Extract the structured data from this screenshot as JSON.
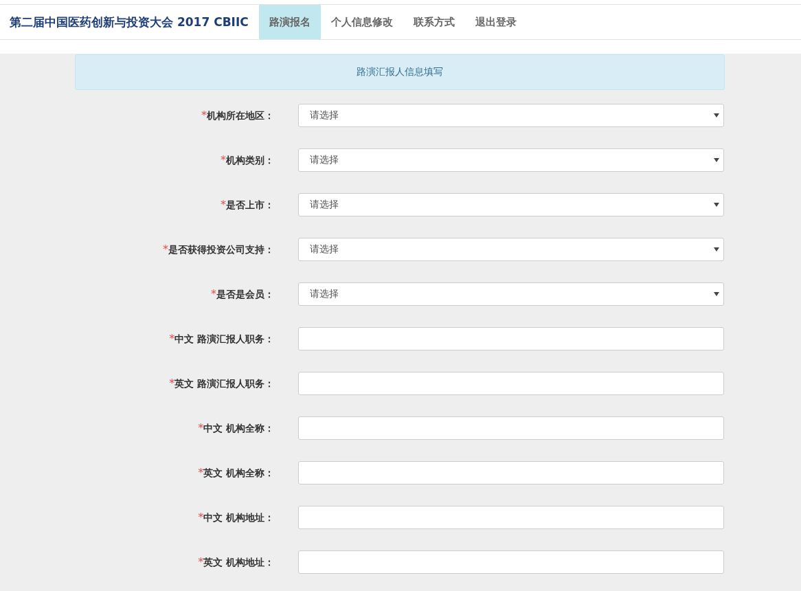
{
  "navbar": {
    "brand": "第二届中国医药创新与投资大会 2017 CBIIC",
    "tabs": [
      {
        "label": "路演报名",
        "selected": true
      },
      {
        "label": "个人信息修改",
        "selected": false
      },
      {
        "label": "联系方式",
        "selected": false
      },
      {
        "label": "退出登录",
        "selected": false
      }
    ]
  },
  "form": {
    "heading": "路演汇报人信息填写",
    "fields": [
      {
        "kind": "select",
        "required_mark": "*",
        "label": "机构所在地区：",
        "value": "请选择"
      },
      {
        "kind": "select",
        "required_mark": "*",
        "label": "机构类别：",
        "value": "请选择"
      },
      {
        "kind": "select",
        "required_mark": "*",
        "label": "是否上市：",
        "value": "请选择"
      },
      {
        "kind": "select",
        "required_mark": "*",
        "label": "是否获得投资公司支持：",
        "value": "请选择"
      },
      {
        "kind": "select",
        "required_mark": "*",
        "label": "是否是会员：",
        "value": "请选择"
      },
      {
        "kind": "text",
        "required_mark": "*",
        "label": "中文 路演汇报人职务："
      },
      {
        "kind": "text",
        "required_mark": "*",
        "label": "英文 路演汇报人职务："
      },
      {
        "kind": "text",
        "required_mark": "*",
        "label": "中文 机构全称："
      },
      {
        "kind": "text",
        "required_mark": "*",
        "label": "英文 机构全称："
      },
      {
        "kind": "text",
        "required_mark": "*",
        "label": "中文 机构地址："
      },
      {
        "kind": "text",
        "required_mark": "*",
        "label": "英文 机构地址："
      }
    ]
  }
}
